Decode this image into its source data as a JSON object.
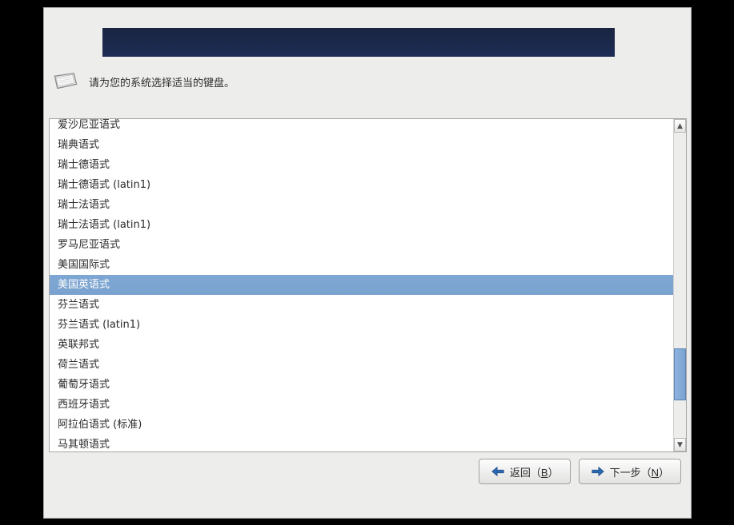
{
  "intro": {
    "text": "请为您的系统选择适当的键盘。"
  },
  "keyboard_list": {
    "items": [
      {
        "label": "爱沙尼亚语式",
        "selected": false
      },
      {
        "label": "瑞典语式",
        "selected": false
      },
      {
        "label": "瑞士德语式",
        "selected": false
      },
      {
        "label": "瑞士德语式 (latin1)",
        "selected": false
      },
      {
        "label": "瑞士法语式",
        "selected": false
      },
      {
        "label": "瑞士法语式 (latin1)",
        "selected": false
      },
      {
        "label": "罗马尼亚语式",
        "selected": false
      },
      {
        "label": "美国国际式",
        "selected": false
      },
      {
        "label": "美国英语式",
        "selected": true
      },
      {
        "label": "芬兰语式",
        "selected": false
      },
      {
        "label": "芬兰语式 (latin1)",
        "selected": false
      },
      {
        "label": "英联邦式",
        "selected": false
      },
      {
        "label": "荷兰语式",
        "selected": false
      },
      {
        "label": "葡萄牙语式",
        "selected": false
      },
      {
        "label": "西班牙语式",
        "selected": false
      },
      {
        "label": "阿拉伯语式 (标准)",
        "selected": false
      },
      {
        "label": "马其顿语式",
        "selected": false
      }
    ]
  },
  "buttons": {
    "back": {
      "prefix": "返回（",
      "mnemonic": "B",
      "suffix": "）"
    },
    "next": {
      "prefix": "下一步（",
      "mnemonic": "N",
      "suffix": "）"
    }
  }
}
